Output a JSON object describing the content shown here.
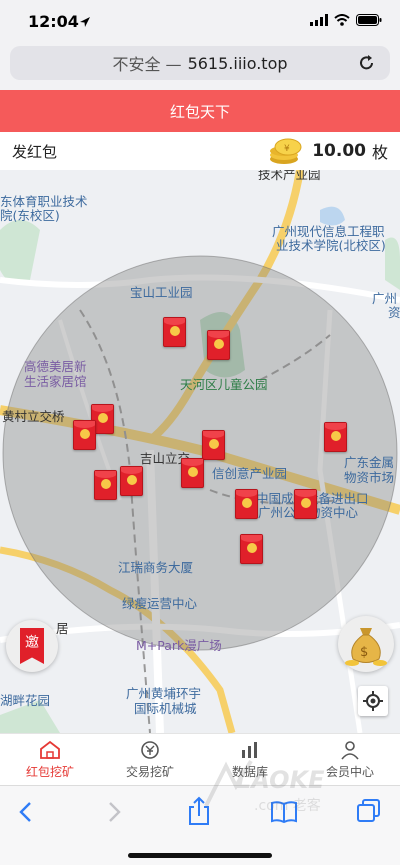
{
  "status_bar": {
    "time": "12:04"
  },
  "browser": {
    "security": "不安全 —",
    "host": "5615.iiio.top"
  },
  "app": {
    "title": "红包天下",
    "send_label": "发红包",
    "balance_value": "10.00",
    "balance_unit": "枚"
  },
  "map": {
    "labels": {
      "top_partial": "技术产业园",
      "school_a": "东体育职业技术",
      "school_a2": "院(东校区)",
      "school_b": "广州现代信息工程职",
      "school_b2": "业技术学院(北校区)",
      "edge_right": "广州",
      "edge_right2": "资",
      "baoshan": "宝山工业园",
      "gaode": "高德美居新",
      "gaode2": "生活家居馆",
      "tianhe": "天河区儿童公园",
      "huangcun": "黄村立交桥",
      "jishan": "吉山立交",
      "xinchuangyi": "信创意产业园",
      "jinshu": "广东金属",
      "jinshu2": "物资市场",
      "zhongguo": "中国成套设备进出口",
      "zhongguo2": "广州公司物资中心",
      "jiangnan": "江瑞商务大厦",
      "lvshou": "绿瘦运营中心",
      "mpark": "M+Park漫广场",
      "ju": "居",
      "huangpu": "广州黄埔环宇",
      "huangpu2": "国际机械城",
      "panhuayuan": "湖畔花园"
    },
    "invite_label": "邀"
  },
  "tabs": [
    {
      "label": "红包挖矿",
      "icon": "home-icon",
      "active": true
    },
    {
      "label": "交易挖矿",
      "icon": "yen-circle-icon",
      "active": false
    },
    {
      "label": "数据库",
      "icon": "bar-chart-icon",
      "active": false
    },
    {
      "label": "会员中心",
      "icon": "person-icon",
      "active": false
    }
  ],
  "colors": {
    "header_red": "#f55a5a",
    "active_tab": "#e53935",
    "envelope": "#e0202a"
  }
}
